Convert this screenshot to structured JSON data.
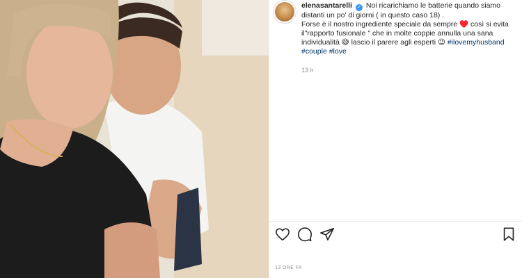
{
  "post": {
    "username": "elenasantarelli",
    "caption_line1": "Noi ricarichiamo le batterie quando siamo distanti un po' di giorni ( in questo caso 18) .",
    "caption_line2_a": "Forse è il nostro ingrediente speciale da sempre ♥️ così si evita il\"rapporto fusionale \" che in molte coppie annulla una sana individualità 😅 lascio il parere agli esperti 😉",
    "hashtag1": "#ilovemyhusband",
    "hashtag2": "#couple",
    "hashtag3": "#love",
    "caption_time": "13 h",
    "post_time": "13 ORE FA"
  },
  "icons": {
    "verified": "verified-badge-icon",
    "like": "heart-icon",
    "comment": "comment-icon",
    "share": "paper-plane-icon",
    "save": "bookmark-icon"
  },
  "colors": {
    "link": "#00376b",
    "verified": "#3897f0",
    "muted": "#8e8e8e"
  }
}
